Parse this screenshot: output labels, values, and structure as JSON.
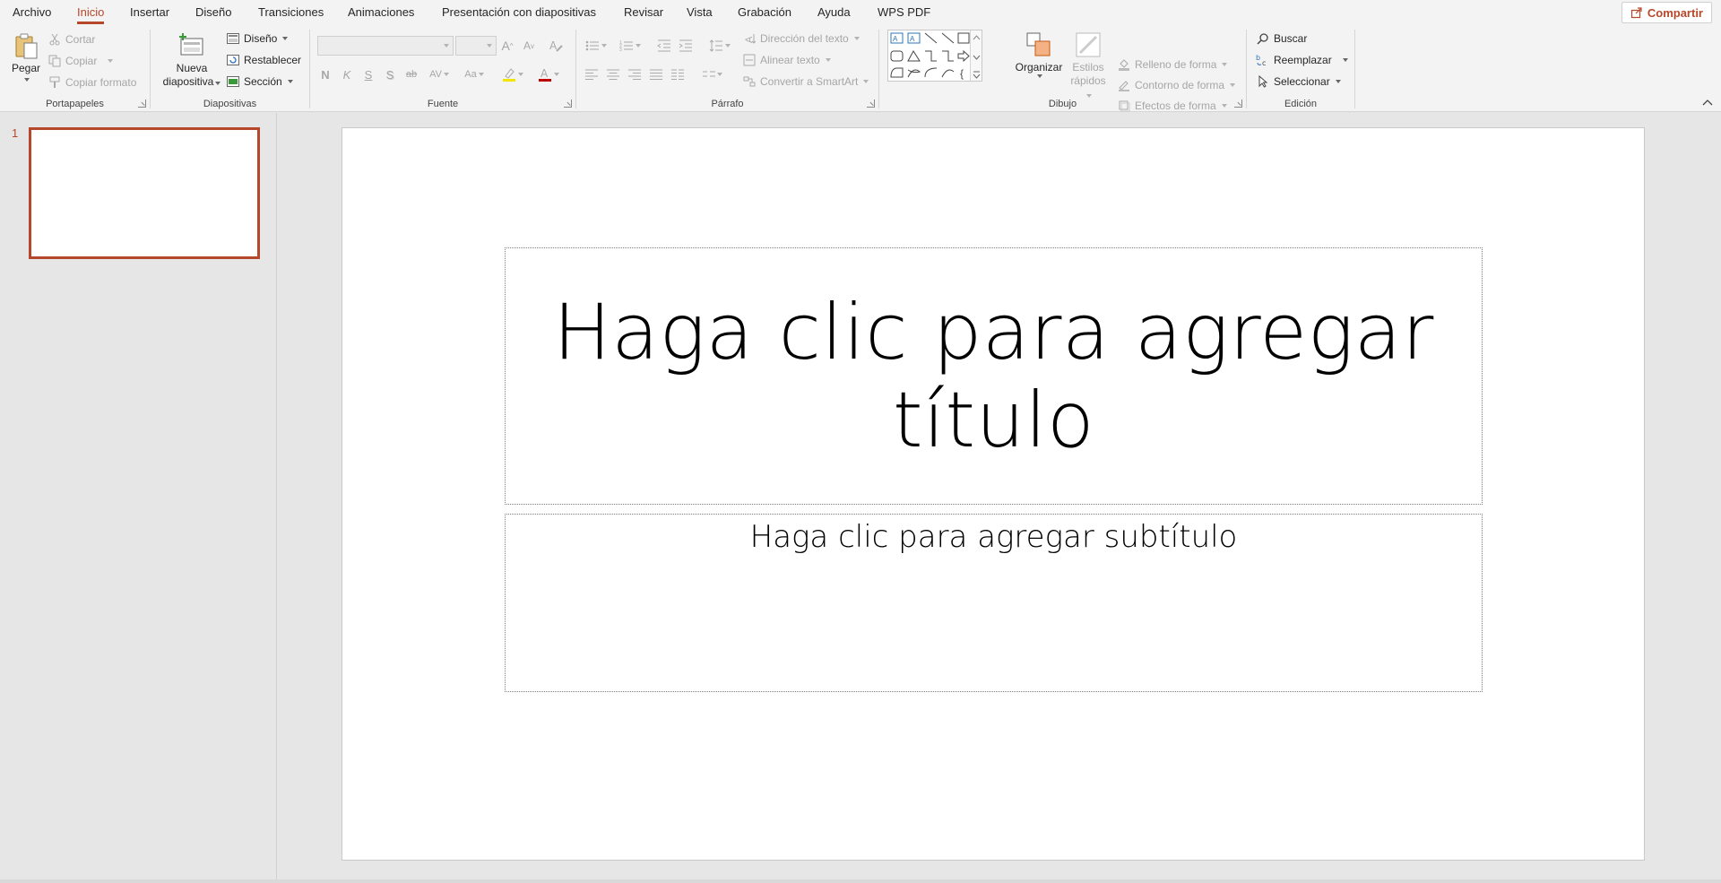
{
  "menu": {
    "tabs": [
      "Archivo",
      "Inicio",
      "Insertar",
      "Diseño",
      "Transiciones",
      "Animaciones",
      "Presentación con diapositivas",
      "Revisar",
      "Vista",
      "Grabación",
      "Ayuda",
      "WPS PDF"
    ],
    "active_tab": "Inicio",
    "share_label": "Compartir"
  },
  "ribbon": {
    "portapapeles": {
      "label": "Portapapeles",
      "paste": "Pegar",
      "cut": "Cortar",
      "copy": "Copiar",
      "copy_format": "Copiar formato"
    },
    "diapositivas": {
      "label": "Diapositivas",
      "new_slide_line1": "Nueva",
      "new_slide_line2": "diapositiva",
      "layout": "Diseño",
      "reset": "Restablecer",
      "section": "Sección"
    },
    "fuente": {
      "label": "Fuente",
      "bold": "N",
      "italic": "K",
      "underline": "S",
      "shadow": "S",
      "strike": "ab",
      "spacing": "AV",
      "case": "Aa",
      "grow": "A",
      "shrink": "A",
      "highlight_color": "#f2e600",
      "font_color": "#c00000"
    },
    "parrafo": {
      "label": "Párrafo",
      "text_direction": "Dirección del texto",
      "align_text": "Alinear texto",
      "convert_smartart": "Convertir a SmartArt"
    },
    "dibujo": {
      "label": "Dibujo",
      "arrange": "Organizar",
      "quick_styles_line1": "Estilos",
      "quick_styles_line2": "rápidos",
      "shape_fill": "Relleno de forma",
      "shape_outline": "Contorno de forma",
      "shape_effects": "Efectos de forma"
    },
    "edicion": {
      "label": "Edición",
      "find": "Buscar",
      "replace": "Reemplazar",
      "select": "Seleccionar"
    }
  },
  "slides_panel": {
    "slide_number": "1"
  },
  "slide": {
    "title_placeholder": "Haga clic para agregar título",
    "subtitle_placeholder": "Haga clic para agregar subtítulo"
  },
  "colors": {
    "accent": "#b7472a",
    "ribbon_bg": "#f3f3f3",
    "workspace_bg": "#e6e6e6"
  }
}
